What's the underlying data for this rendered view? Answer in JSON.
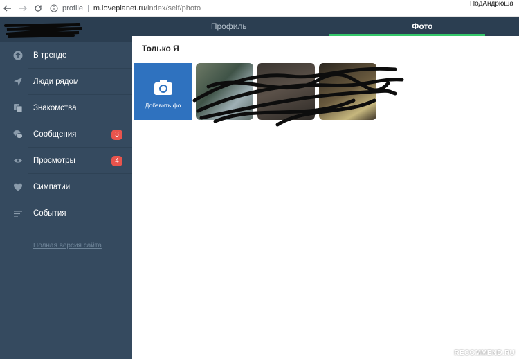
{
  "browser": {
    "scheme": "profile",
    "host": "m.loveplanet.ru",
    "path": "/index/self/photo",
    "user": "ПодАндрюша"
  },
  "sidebar": {
    "items": [
      {
        "label": "В тренде",
        "icon": "arrow-up-icon"
      },
      {
        "label": "Люди рядом",
        "icon": "navigation-arrow-icon"
      },
      {
        "label": "Знакомства",
        "icon": "cards-icon"
      },
      {
        "label": "Сообщения",
        "icon": "chat-bubbles-icon",
        "badge": "3"
      },
      {
        "label": "Просмотры",
        "icon": "eye-icon",
        "badge": "4"
      },
      {
        "label": "Симпатии",
        "icon": "heart-icon"
      },
      {
        "label": "События",
        "icon": "list-icon"
      }
    ],
    "full_version": "Полная версия сайта"
  },
  "tabs": [
    {
      "label": "Профиль",
      "active": false
    },
    {
      "label": "Фото",
      "active": true
    }
  ],
  "content": {
    "title": "Только Я",
    "add_photo_label": "Добавить фо"
  },
  "watermark": "RECOMMEND.RU",
  "colors": {
    "sidebar": "#354a5f",
    "header": "#2b3e51",
    "accent_green": "#35c66a",
    "add_button": "#2f72bf",
    "badge": "#e8544d"
  }
}
